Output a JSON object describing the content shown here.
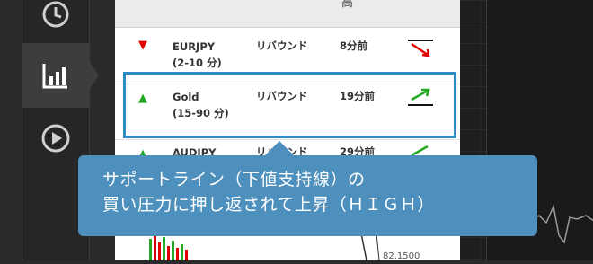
{
  "header": {
    "col_partial": "高"
  },
  "signals": [
    {
      "direction": "down",
      "direction_glyph": "▼",
      "pair": "EURJPY",
      "period": "(2-10 分)",
      "pattern": "リバウンド",
      "time": "8分前",
      "icon": "trend-down-icon"
    },
    {
      "direction": "up",
      "direction_glyph": "▲",
      "pair": "Gold",
      "period": "(15-90 分)",
      "pattern": "リバウンド",
      "time": "19分前",
      "icon": "trend-up-icon"
    },
    {
      "direction": "up",
      "direction_glyph": "▲",
      "pair": "AUDJPY",
      "period": "",
      "pattern": "リバウンド",
      "time": "29分前",
      "icon": "trend-up-icon"
    }
  ],
  "tooltip": {
    "line1": "サポートライン（下値支持線）の",
    "line2": "買い圧力に押し返されて上昇（ＨＩＧＨ）"
  },
  "chart": {
    "price_label": "82.1500"
  },
  "colors": {
    "accent": "#2d8cc6",
    "tooltip_bg": "#4d8fbd",
    "down": "#e00000",
    "up": "#22aa22"
  }
}
